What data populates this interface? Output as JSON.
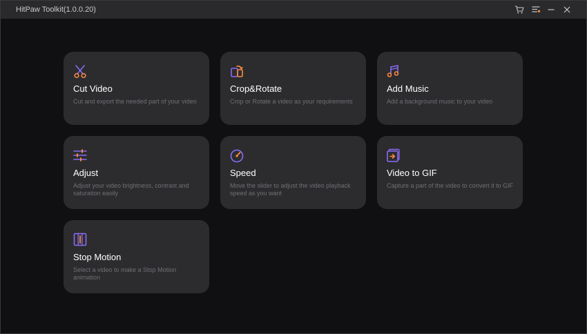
{
  "window": {
    "title": "HitPaw Toolkit(1.0.0.20)",
    "controls": [
      {
        "name": "cart-icon"
      },
      {
        "name": "menu-list-icon"
      },
      {
        "name": "minimize-icon"
      },
      {
        "name": "close-icon"
      }
    ]
  },
  "colors": {
    "background": "#101013",
    "titlebar": "#2a2a2d",
    "card": "#2c2c2f",
    "accent_purple": "#8b6cf6",
    "accent_orange": "#ff8a3d",
    "text_primary": "#ffffff",
    "text_secondary": "#707075"
  },
  "tools": [
    {
      "title": "Cut Video",
      "description": "Cut and export the needed part of your video",
      "icon": "scissors-icon"
    },
    {
      "title": "Crop&Rotate",
      "description": "Crop or Rotate a video as your requirements",
      "icon": "crop-rotate-icon"
    },
    {
      "title": "Add Music",
      "description": "Add a background music to your video",
      "icon": "music-note-icon"
    },
    {
      "title": "Adjust",
      "description": "Adjust your video brightness, contrast and saturation easily",
      "icon": "sliders-icon"
    },
    {
      "title": "Speed",
      "description": "Move the slider to adjust the video playback speed as you want",
      "icon": "speedometer-icon"
    },
    {
      "title": "Video to GIF",
      "description": "Capture a part of the video to convert it to GIF",
      "icon": "video-to-gif-icon"
    },
    {
      "title": "Stop Motion",
      "description": "Select a video to make a Stop Motion animation",
      "icon": "film-frames-icon"
    }
  ]
}
